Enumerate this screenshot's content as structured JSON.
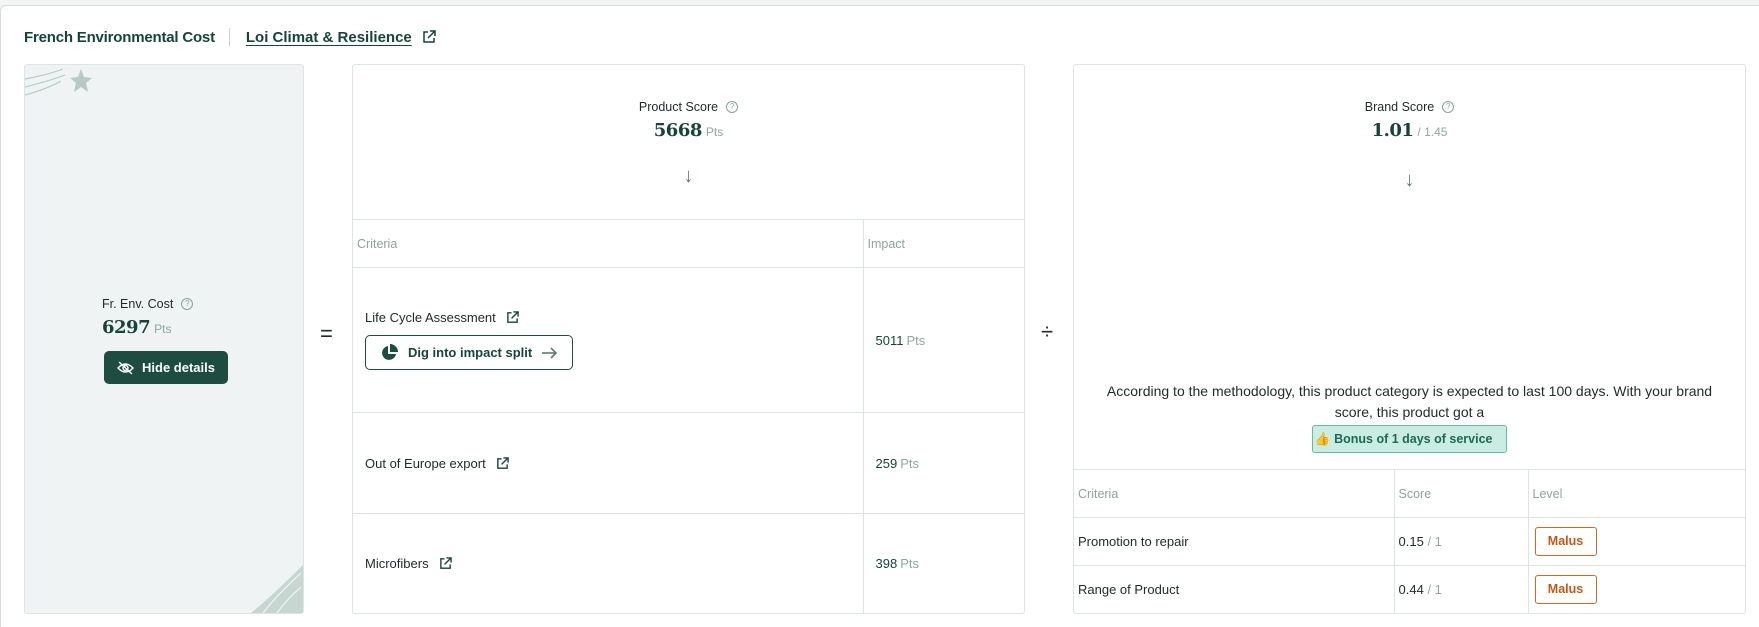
{
  "header": {
    "title": "French Environmental Cost",
    "law_link": "Loi Climat & Resilience"
  },
  "total": {
    "label": "Fr. Env. Cost",
    "value": "6297",
    "unit": "Pts",
    "hide_button": "Hide details"
  },
  "operators": {
    "equals": "=",
    "divide": "÷"
  },
  "product": {
    "label": "Product Score",
    "value": "5668",
    "unit": "Pts",
    "columns": {
      "criteria": "Criteria",
      "impact": "Impact"
    },
    "rows": [
      {
        "name": "Life Cycle Assessment",
        "impact": "5011",
        "unit": "Pts",
        "button": "Dig into impact split"
      },
      {
        "name": "Out of Europe export",
        "impact": "259",
        "unit": "Pts"
      },
      {
        "name": "Microfibers",
        "impact": "398",
        "unit": "Pts"
      }
    ]
  },
  "brand": {
    "label": "Brand Score",
    "value": "1.01",
    "max": "/ 1.45",
    "description": "According to the methodology, this product category is expected to last 100 days. With your brand score, this product got a",
    "bonus_emoji": "👍",
    "bonus": "Bonus of 1 days of service",
    "columns": {
      "criteria": "Criteria",
      "score": "Score",
      "level": "Level"
    },
    "rows": [
      {
        "name": "Promotion to repair",
        "score": "0.15",
        "max": "/ 1",
        "level": "Malus"
      },
      {
        "name": "Range of Product",
        "score": "0.44",
        "max": "/ 1",
        "level": "Malus"
      }
    ]
  },
  "colors": {
    "brand": "#1c4d40",
    "accent_text": "#154538",
    "malus": "#c05a18",
    "bonus_bg": "#c9ede3"
  }
}
